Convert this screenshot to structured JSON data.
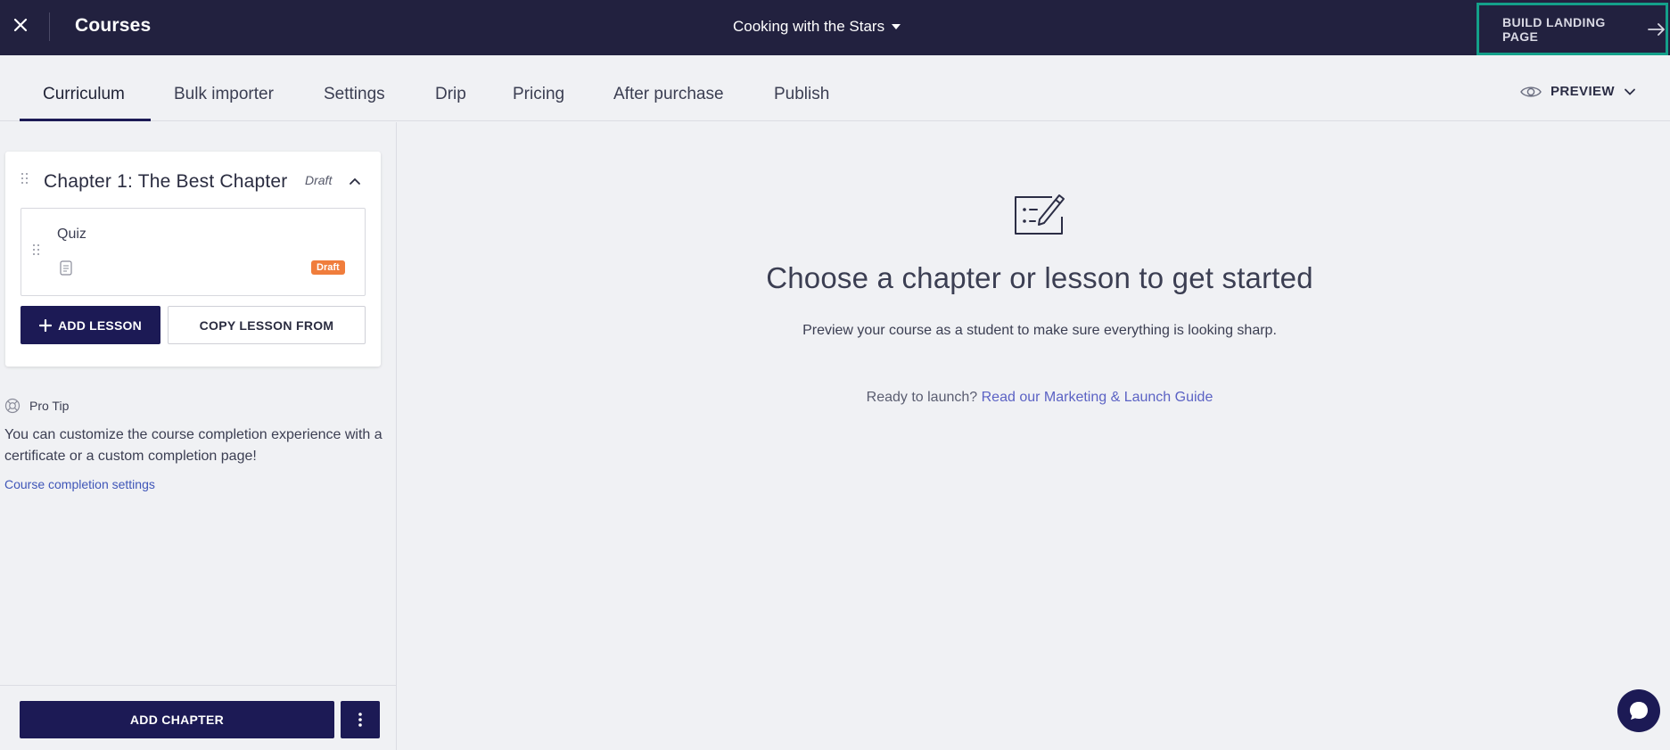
{
  "topbar": {
    "close_icon": "close-icon",
    "title": "Courses",
    "course_name": "Cooking with the Stars",
    "build_landing_page": "BUILD LANDING PAGE",
    "build_icon": "arrow-right-icon"
  },
  "tabs": [
    {
      "label": "Curriculum",
      "active": true
    },
    {
      "label": "Bulk importer"
    },
    {
      "label": "Settings"
    },
    {
      "label": "Drip"
    },
    {
      "label": "Pricing"
    },
    {
      "label": "After purchase"
    },
    {
      "label": "Publish"
    }
  ],
  "preview": {
    "label": "PREVIEW",
    "icon": "eye-icon"
  },
  "sidebar": {
    "chapter": {
      "title": "Chapter 1: The Best Chapter",
      "status": "Draft",
      "lessons": [
        {
          "title": "Quiz",
          "type_icon": "quiz-icon",
          "badge": "Draft"
        }
      ],
      "add_lesson_label": "ADD LESSON",
      "copy_lesson_label": "COPY LESSON FROM"
    },
    "pro_tip": {
      "label": "Pro Tip",
      "text": "You can customize the course completion experience with a certificate or a custom completion page!",
      "link": "Course completion settings"
    },
    "add_chapter_label": "ADD CHAPTER"
  },
  "main": {
    "heading": "Choose a chapter or lesson to get started",
    "subtext": "Preview your course as a student to make sure everything is looking sharp.",
    "launch_prefix": "Ready to launch?",
    "launch_link": "Read our Marketing & Launch Guide"
  },
  "colors": {
    "topbar_bg": "#22213f",
    "primary": "#1c1a55",
    "highlight_border": "#14a08a",
    "badge_orange": "#f07d3c",
    "link": "#3f56b8"
  }
}
